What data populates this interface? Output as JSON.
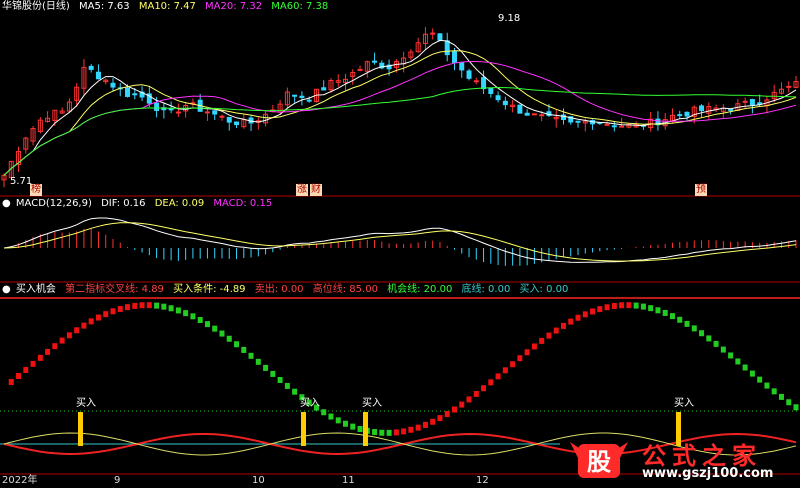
{
  "colors": {
    "bg": "#000000",
    "up": "#ff3333",
    "down": "#33d6ff",
    "ma5": "#ffffff",
    "ma10": "#ffff66",
    "ma20": "#ff33ff",
    "ma60": "#33ff33",
    "divider": "#b00000",
    "green_bar": "#22cc22",
    "red_bar": "#ee1111",
    "signal": "#ffcc00",
    "cyan": "#33cccc"
  },
  "main_panel": {
    "title": "华锦股份(日线)",
    "ma5_label": "MA5: 7.63",
    "ma10_label": "MA10: 7.47",
    "ma20_label": "MA20: 7.32",
    "ma60_label": "MA60: 7.38",
    "high_label": "9.18",
    "low_label": "5.71",
    "events": [
      "榜",
      "涨",
      "财",
      "预"
    ]
  },
  "macd_panel": {
    "title": "MACD(12,26,9)",
    "dif": "DIF: 0.16",
    "dea": "DEA: 0.09",
    "macd": "MACD: 0.15"
  },
  "signal_panel": {
    "title": "买入机会",
    "l1": "第二指标交叉线: 4.89",
    "l2": "买入条件: -4.89",
    "l3": "卖出: 0.00",
    "l4": "高位线: 85.00",
    "l5": "机会线: 20.00",
    "l6": "底线: 0.00",
    "l7": "买入: 0.00",
    "buy_label": "买入"
  },
  "x_axis": {
    "labels": [
      "2022年",
      "9",
      "10",
      "11",
      "12"
    ]
  },
  "watermark": {
    "text": "公式之家",
    "url": "www.gszj100.com",
    "logo_char": "股"
  },
  "chart_data": {
    "type": "candlestick",
    "price_extremes": {
      "high": 9.18,
      "low": 5.71
    },
    "moving_averages": {
      "MA5": 7.63,
      "MA10": 7.47,
      "MA20": 7.32,
      "MA60": 7.38
    },
    "close_anchors": [
      5.75,
      6.6,
      7.1,
      7.2,
      8.2,
      7.9,
      7.6,
      7.5,
      7.1,
      7.35,
      7.2,
      7.0,
      6.9,
      7.15,
      7.6,
      7.5,
      7.8,
      8.0,
      8.3,
      8.2,
      8.6,
      9.0,
      8.4,
      7.9,
      7.6,
      7.3,
      7.1,
      7.0,
      6.9,
      7.0,
      6.9,
      6.85,
      6.95,
      7.1,
      7.2,
      7.25,
      7.3,
      7.4,
      7.6,
      7.8
    ],
    "macd": {
      "DIF": 0.16,
      "DEA": 0.09,
      "MACD": 0.15
    },
    "signal_levels": {
      "high_line": 85,
      "chance_line": 20,
      "bottom_line": 0
    },
    "buy_signals": 4
  }
}
